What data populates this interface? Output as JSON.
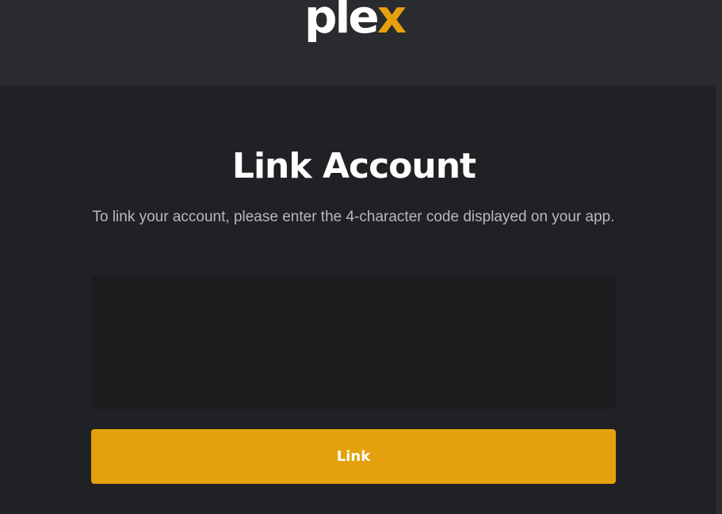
{
  "header": {
    "logo": {
      "text_main": "ple",
      "text_accent": "x"
    }
  },
  "main": {
    "title": "Link Account",
    "instructions": "To link your account, please enter the 4-character code displayed on your app.",
    "code_input": {
      "value": "",
      "placeholder": ""
    },
    "link_button_label": "Link"
  },
  "colors": {
    "accent": "#e5a00d",
    "background": "#2a2b2f",
    "card": "#202124",
    "input": "#1b1c1e"
  }
}
